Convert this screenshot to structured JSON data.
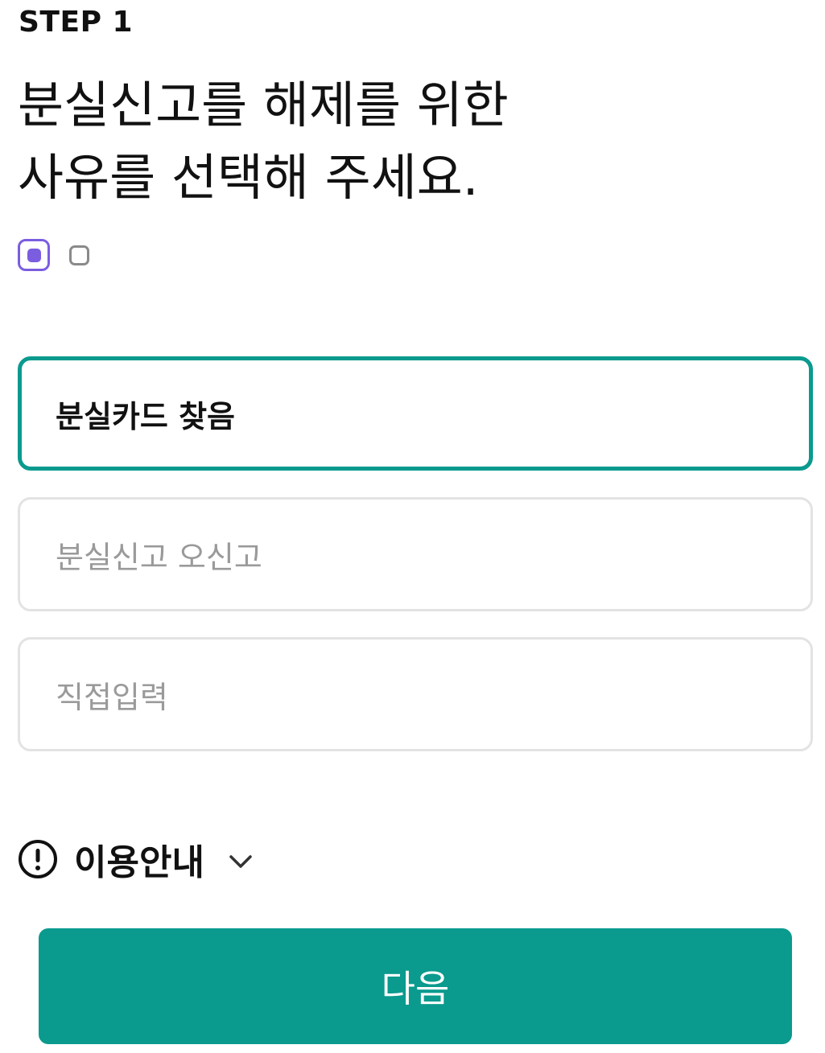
{
  "header": {
    "step_label": "STEP 1",
    "title_line1": "분실신고를 해제를 위한",
    "title_line2": "사유를 선택해 주세요."
  },
  "step_indicator": {
    "current": 1,
    "total": 2,
    "active_color": "#7b5de0",
    "inactive_color": "#8a8a8a"
  },
  "reasons": {
    "selected_index": 0,
    "options": [
      {
        "label": "분실카드 찾음"
      },
      {
        "label": "분실신고 오신고"
      },
      {
        "label": "직접입력"
      }
    ]
  },
  "info": {
    "label": "이용안내",
    "icon": "exclamation-circle-icon",
    "expand_icon": "chevron-down-icon"
  },
  "footer": {
    "next_label": "다음"
  },
  "colors": {
    "accent": "#0a9a8e",
    "step_active": "#7b5de0",
    "border_default": "#e3e3e3",
    "placeholder_text": "#9a9a9a"
  }
}
